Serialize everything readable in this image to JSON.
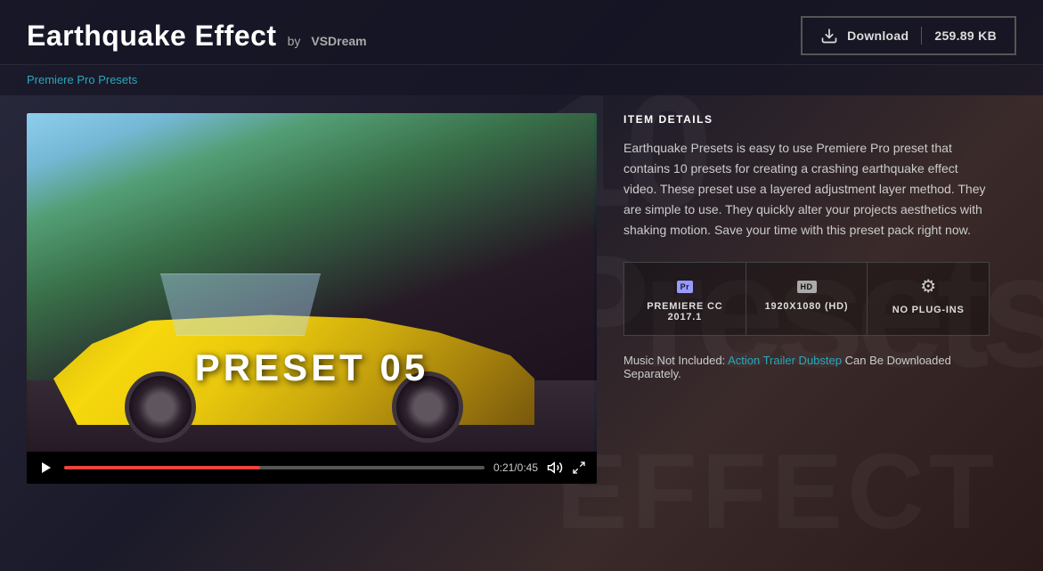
{
  "header": {
    "title": "Earthquake Effect",
    "by_label": "by",
    "author": "VSDream",
    "download_label": "Download",
    "download_size": "259.89 KB"
  },
  "breadcrumb": {
    "label": "Premiere Pro Presets"
  },
  "video": {
    "preset_text": "PRESET 05",
    "time_current": "0:21",
    "time_total": "0:45",
    "progress_percent": 46.7
  },
  "details": {
    "section_label": "ITEM DETAILS",
    "description": "Earthquake Presets is easy to use Premiere Pro preset that contains 10 presets for creating a crashing earthquake effect video. These preset use a layered adjustment layer method. They are simple to use. They quickly alter your projects aesthetics with shaking motion. Save your time with this preset pack right now.",
    "features": [
      {
        "icon": "pr-icon",
        "label": "PREMIERE CC 2017.1"
      },
      {
        "icon": "hd-icon",
        "label": "1920X1080 (HD)"
      },
      {
        "icon": "gear-icon",
        "label": "NO PLUG-INS"
      }
    ],
    "music_prefix": "Music Not Included:",
    "music_link_text": "Action Trailer Dubstep",
    "music_suffix": "Can Be Downloaded Separately."
  }
}
